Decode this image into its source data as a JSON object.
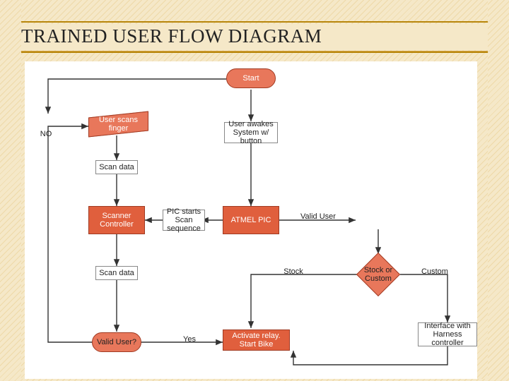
{
  "title": "TRAINED USER FLOW DIAGRAM",
  "nodes": {
    "start": "Start",
    "user_awakes": "User awakes System w/ button",
    "user_scans": "User scans finger",
    "scan_data_top": "Scan data",
    "scanner_controller": "Scanner Controller",
    "pic_starts": "PIC starts Scan sequence",
    "atmel": "ATMEL PIC",
    "scan_data_bottom": "Scan data",
    "valid_user_q": "Valid User?",
    "activate": "Activate relay. Start Bike",
    "stock_or_custom": "Stock or Custom",
    "interface_harness": "Interface with Harness controller"
  },
  "labels": {
    "no": "NO",
    "valid_user": "Valid User",
    "stock": "Stock",
    "custom": "Custom",
    "yes": "Yes"
  }
}
